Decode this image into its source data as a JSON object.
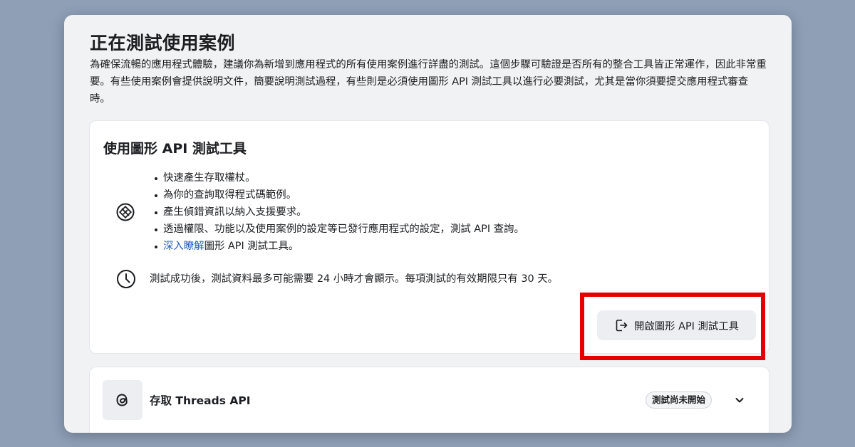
{
  "page": {
    "title": "正在測試使用案例",
    "description": "為確保流暢的應用程式體驗，建議你為新增到應用程式的所有使用案例進行詳盡的測試。這個步驟可驗證是否所有的整合工具皆正常運作，因此非常重要。有些使用案例會提供說明文件，簡要說明測試過程，有些則是必須使用圖形 API 測試工具以進行必要測試，尤其是當你須要提交應用程式審查時。"
  },
  "graph_tool_card": {
    "title": "使用圖形 API 測試工具",
    "icon": "graph-api-explorer-icon",
    "bullets": [
      "快速產生存取權杖。",
      "為你的查詢取得程式碼範例。",
      "產生偵錯資訊以納入支援要求。",
      "透過權限、功能以及使用案例的設定等已發行應用程式的設定，測試 API 查詢。"
    ],
    "learn_more_link": "深入瞭解",
    "learn_more_suffix": "圖形 API 測試工具。",
    "note_icon": "clock-icon",
    "note": "測試成功後，測試資料最多可能需要 24 小時才會顯示。每項測試的有效期限只有 30 天。",
    "open_button": "開啟圖形 API 測試工具",
    "open_button_icon": "external-open-icon",
    "highlight_color": "#e40000"
  },
  "threads_card": {
    "icon": "threads-icon",
    "title": "存取 Threads API",
    "status": "測試尚未開始",
    "expand_icon": "chevron-down-icon"
  }
}
